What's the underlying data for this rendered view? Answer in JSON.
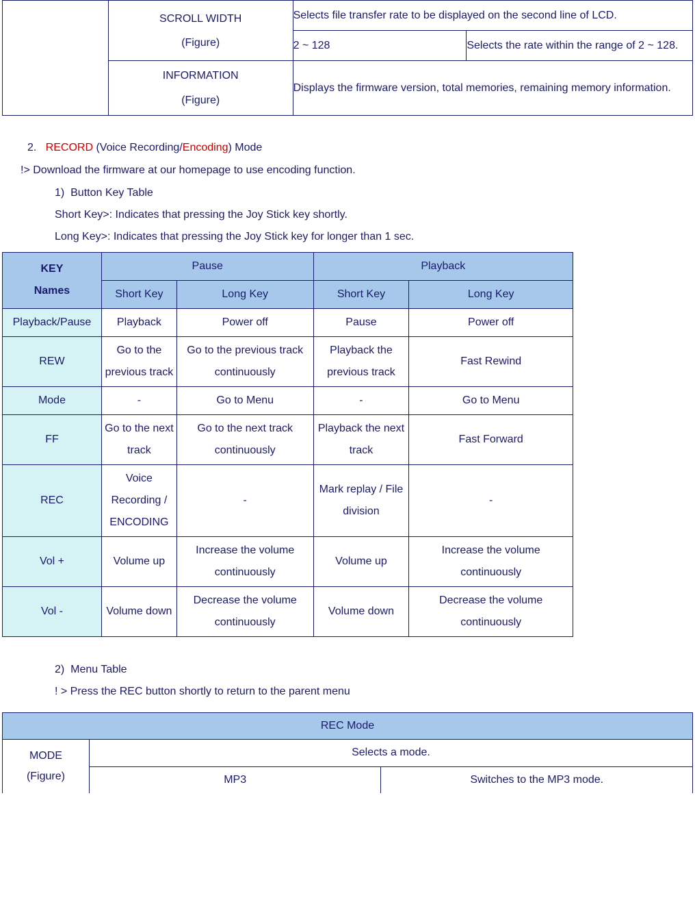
{
  "top_table": {
    "scroll_width": {
      "label1": "SCROLL WIDTH",
      "label2": "(Figure)"
    },
    "scroll_desc": "Selects file transfer rate to be displayed on the second line of LCD.",
    "scroll_range": "2 ~ 128",
    "scroll_range_desc": "Selects the rate within the range of 2 ~ 128.",
    "info": {
      "label1": "INFORMATION",
      "label2": "(Figure)"
    },
    "info_desc": "Displays the firmware version, total memories, remaining memory information."
  },
  "section2": {
    "num": "2.",
    "title_red1": "RECORD",
    "title_mid": " (Voice Recording/",
    "title_red2": "Encoding",
    "title_end": ") Mode",
    "note": "!> Download the firmware at our homepage to use encoding function.",
    "sub1_num": "1)",
    "sub1_title": "Button Key Table",
    "short_note": "Short Key>: Indicates that pressing the Joy Stick key shortly.",
    "long_note": "Long Key>: Indicates that pressing the Joy Stick key for longer than 1 sec."
  },
  "key_table": {
    "h_key1": "KEY",
    "h_key2": "Names",
    "h_pause": "Pause",
    "h_playback": "Playback",
    "h_short": "Short Key",
    "h_long": "Long Key",
    "rows": [
      {
        "name": "Playback/Pause",
        "psk": "Playback",
        "plk": "Power off",
        "bsk": "Pause",
        "blk": "Power off"
      },
      {
        "name": "REW",
        "psk": "Go to the previous track",
        "plk": "Go to the previous track continuously",
        "bsk": "Playback the previous track",
        "blk": "Fast Rewind"
      },
      {
        "name": "Mode",
        "psk": "-",
        "plk": "Go to Menu",
        "bsk": "-",
        "blk": "Go to Menu"
      },
      {
        "name": "FF",
        "psk": "Go to the next track",
        "plk": "Go to the next track continuously",
        "bsk": "Playback the next track",
        "blk": "Fast Forward"
      },
      {
        "name": "REC",
        "psk": "Voice Recording / ENCODING",
        "plk": "-",
        "bsk": "Mark replay / File division",
        "blk": "-"
      },
      {
        "name": "Vol +",
        "psk": "Volume up",
        "plk": "Increase the volume continuously",
        "bsk": "Volume up",
        "blk": "Increase the volume continuously"
      },
      {
        "name": "Vol -",
        "psk": "Volume down",
        "plk": "Decrease the volume continuously",
        "bsk": "Volume down",
        "blk": "Decrease the volume continuously"
      }
    ]
  },
  "menu_table_section": {
    "sub2_num": "2)",
    "sub2_title": "Menu Table",
    "note": "! > Press the REC button shortly to return to the parent menu"
  },
  "rec_table": {
    "header": "REC Mode",
    "mode1": "MODE",
    "mode2": "(Figure)",
    "selects": "Selects a mode.",
    "mp3": "MP3",
    "mp3_desc": "Switches to the MP3 mode."
  }
}
